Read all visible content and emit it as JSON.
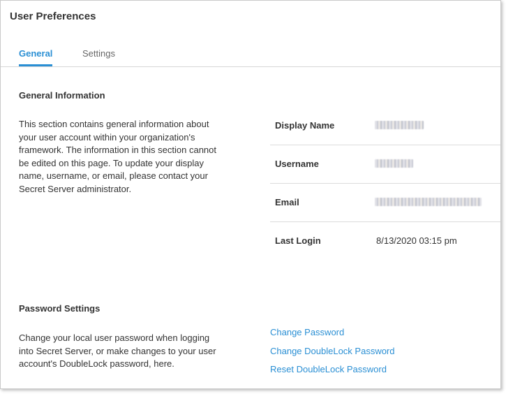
{
  "page": {
    "title": "User Preferences"
  },
  "tabs": [
    {
      "label": "General",
      "active": true
    },
    {
      "label": "Settings",
      "active": false
    }
  ],
  "general": {
    "heading": "General Information",
    "description": "This section contains general information about your user account within your organization's framework. The information in this section cannot be edited on this page. To update your display name, username, or email, please contact your Secret Server administrator.",
    "fields": [
      {
        "label": "Display Name",
        "value": "",
        "redacted": true
      },
      {
        "label": "Username",
        "value": "",
        "redacted": true
      },
      {
        "label": "Email",
        "value": "",
        "redacted": true
      },
      {
        "label": "Last Login",
        "value": "8/13/2020 03:15 pm",
        "redacted": false
      }
    ]
  },
  "password": {
    "heading": "Password Settings",
    "description": "Change your local user password when logging into Secret Server, or make changes to your user account's DoubleLock password, here.",
    "links": [
      "Change Password",
      "Change DoubleLock Password",
      "Reset DoubleLock Password"
    ]
  },
  "colors": {
    "accent": "#2a8fd4",
    "text": "#333333",
    "divider": "#dcdcdc"
  }
}
